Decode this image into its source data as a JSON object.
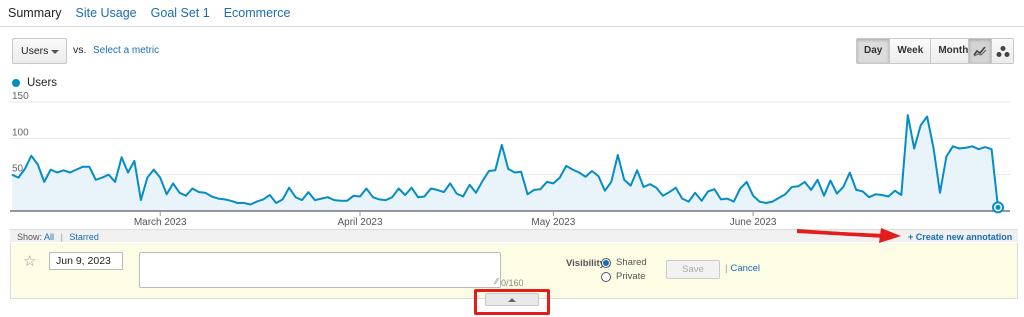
{
  "tabs": [
    {
      "label": "Summary",
      "active": true
    },
    {
      "label": "Site Usage",
      "active": false
    },
    {
      "label": "Goal Set 1",
      "active": false
    },
    {
      "label": "Ecommerce",
      "active": false
    }
  ],
  "metric_selector": {
    "value": "Users",
    "vs_label": "vs.",
    "secondary_placeholder": "Select a metric"
  },
  "time_range": {
    "options": [
      "Day",
      "Week",
      "Month"
    ],
    "selected": "Day"
  },
  "chart_type_buttons": [
    {
      "icon": "line-chart-icon",
      "active": true
    },
    {
      "icon": "motion-chart-icon",
      "active": false
    }
  ],
  "colors": {
    "series": "#058dc7",
    "fill": "#e8f4fa",
    "link": "#1a6db3",
    "highlight_red": "#e51c1c"
  },
  "chart_data": {
    "type": "area",
    "legend": [
      "Users"
    ],
    "y_ticks": [
      150,
      100,
      50
    ],
    "x_tick_labels": [
      "March 2023",
      "April 2023",
      "May 2023",
      "June 2023"
    ],
    "ylim": [
      0,
      160
    ],
    "grid": true,
    "series": [
      {
        "name": "Users",
        "values": [
          50,
          46,
          58,
          76,
          64,
          40,
          57,
          53,
          56,
          53,
          57,
          61,
          61,
          43,
          46,
          50,
          40,
          74,
          53,
          69,
          15,
          46,
          57,
          46,
          23,
          38,
          25,
          21,
          31,
          26,
          25,
          20,
          17,
          16,
          14,
          11,
          11,
          9,
          13,
          16,
          22,
          11,
          16,
          32,
          19,
          15,
          26,
          15,
          17,
          19,
          15,
          14,
          14,
          21,
          20,
          31,
          19,
          16,
          15,
          19,
          31,
          22,
          32,
          19,
          20,
          31,
          29,
          26,
          38,
          24,
          20,
          36,
          25,
          41,
          55,
          56,
          91,
          58,
          53,
          54,
          23,
          29,
          30,
          40,
          38,
          46,
          62,
          57,
          53,
          47,
          55,
          48,
          28,
          40,
          77,
          43,
          35,
          56,
          33,
          37,
          32,
          21,
          26,
          32,
          17,
          13,
          25,
          14,
          27,
          30,
          16,
          17,
          13,
          31,
          40,
          21,
          13,
          11,
          13,
          18,
          23,
          33,
          34,
          40,
          29,
          43,
          21,
          42,
          24,
          33,
          53,
          29,
          27,
          19,
          23,
          22,
          20,
          28,
          22,
          132,
          86,
          118,
          130,
          86,
          25,
          75,
          89,
          86,
          87,
          89,
          85,
          88,
          85,
          5
        ]
      }
    ]
  },
  "annotations": {
    "show_label": "Show:",
    "filters": [
      "All",
      "Starred"
    ],
    "create_label": "+ Create new annotation",
    "new": {
      "date": "Jun 9, 2023",
      "note": "",
      "counter": "0/160",
      "visibility_label": "Visibility:",
      "visibility_options": [
        "Shared",
        "Private"
      ],
      "selected_visibility": "Shared",
      "save_label": "Save",
      "cancel_label": "Cancel"
    }
  }
}
